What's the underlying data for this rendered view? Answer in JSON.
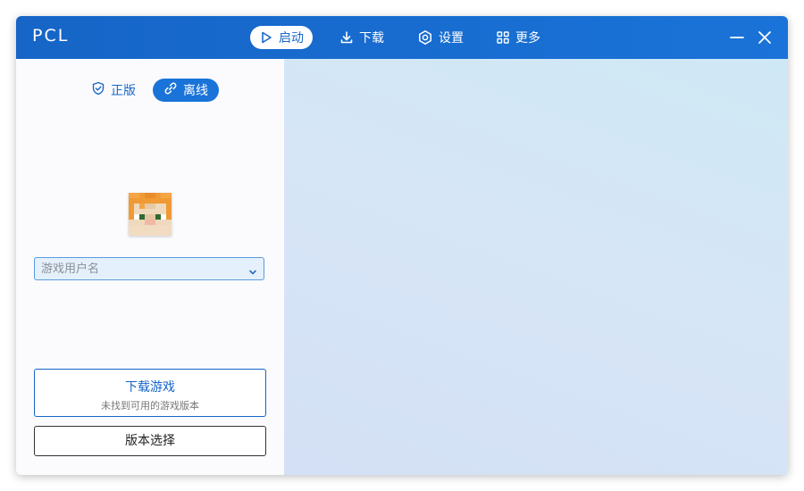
{
  "app": {
    "title": "PCL"
  },
  "nav": {
    "items": [
      {
        "label": "启动",
        "icon": "play-icon",
        "active": true
      },
      {
        "label": "下载",
        "icon": "download-icon",
        "active": false
      },
      {
        "label": "设置",
        "icon": "settings-icon",
        "active": false
      },
      {
        "label": "更多",
        "icon": "grid-icon",
        "active": false
      }
    ]
  },
  "window_controls": {
    "minimize_icon": "minimize-icon",
    "close_icon": "close-icon"
  },
  "account": {
    "tabs": [
      {
        "label": "正版",
        "icon": "shield-check-icon",
        "active": false
      },
      {
        "label": "离线",
        "icon": "link-icon",
        "active": true
      }
    ],
    "avatar": "alex-skin-head",
    "username": {
      "value": "",
      "placeholder": "游戏用户名"
    }
  },
  "actions": {
    "download_title": "下载游戏",
    "download_subtitle": "未找到可用的游戏版本",
    "version_select": "版本选择"
  },
  "colors": {
    "titlebar": "#1a6fd3",
    "accent": "#1a73d8",
    "sidebar_bg": "#fbfbfe",
    "main_bg": "#d4e6f6"
  }
}
